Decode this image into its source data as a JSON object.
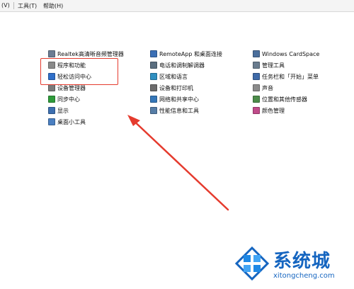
{
  "menu": [
    {
      "label": "(V)"
    },
    {
      "label": "工具(T)"
    },
    {
      "label": "帮助(H)"
    }
  ],
  "columns": [
    {
      "items": [
        {
          "label": "Realtek高清晰音频管理器",
          "icon": "speaker-icon",
          "color": "#6b7c93"
        },
        {
          "label": "程序和功能",
          "icon": "programs-icon",
          "color": "#8a8a8a"
        },
        {
          "label": "轻松访问中心",
          "icon": "ease-of-access-icon",
          "color": "#2f6fc9"
        },
        {
          "label": "设备管理器",
          "icon": "device-manager-icon",
          "color": "#7b7b7b"
        },
        {
          "label": "同步中心",
          "icon": "sync-icon",
          "color": "#2e9b3a"
        },
        {
          "label": "显示",
          "icon": "display-icon",
          "color": "#3d6fb0"
        },
        {
          "label": "桌面小工具",
          "icon": "gadgets-icon",
          "color": "#4a7fc1"
        }
      ]
    },
    {
      "items": [
        {
          "label": "RemoteApp 和桌面连接",
          "icon": "remote-desktop-icon",
          "color": "#3a6fb5"
        },
        {
          "label": "电话和调制解调器",
          "icon": "phone-icon",
          "color": "#5a6e7f"
        },
        {
          "label": "区域和语言",
          "icon": "globe-icon",
          "color": "#2f8fc0"
        },
        {
          "label": "设备和打印机",
          "icon": "printer-icon",
          "color": "#6c6c6c"
        },
        {
          "label": "网络和共享中心",
          "icon": "network-icon",
          "color": "#3577b8"
        },
        {
          "label": "性能信息和工具",
          "icon": "performance-icon",
          "color": "#567da6"
        }
      ]
    },
    {
      "items": [
        {
          "label": "Windows CardSpace",
          "icon": "cardspace-icon",
          "color": "#4b6f9c"
        },
        {
          "label": "管理工具",
          "icon": "admin-tools-icon",
          "color": "#6a7c8e"
        },
        {
          "label": "任务栏和「开始」菜单",
          "icon": "taskbar-icon",
          "color": "#3f6aa8"
        },
        {
          "label": "声音",
          "icon": "sound-icon",
          "color": "#8b8b8b"
        },
        {
          "label": "位置和其他传感器",
          "icon": "location-sensor-icon",
          "color": "#4c8c4a"
        },
        {
          "label": "颜色管理",
          "icon": "color-management-icon",
          "color": "#c04b8a"
        }
      ]
    }
  ],
  "highlight_color": "#e53b2e",
  "watermark": {
    "title": "系统城",
    "url": "xitongcheng.com",
    "color": "#1565c0"
  }
}
